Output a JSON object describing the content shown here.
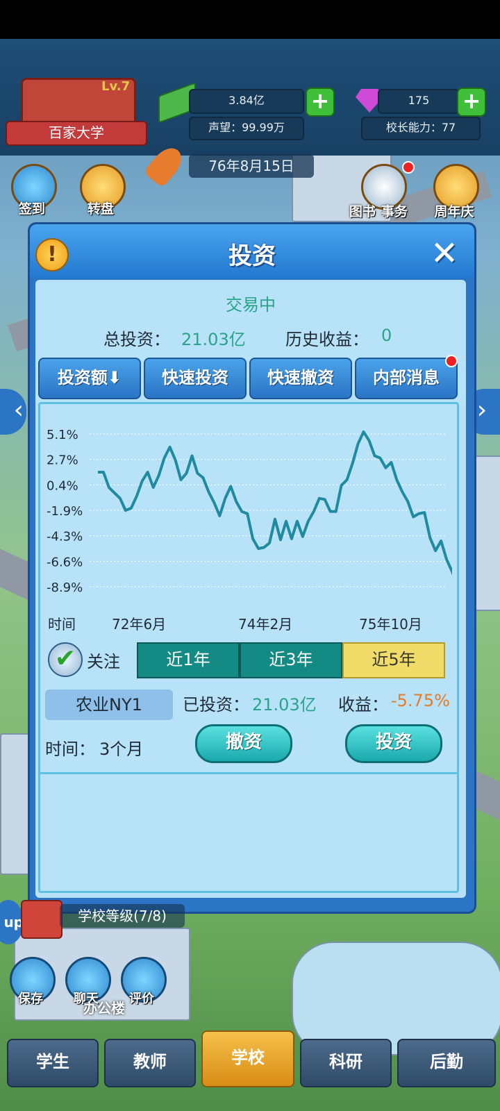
{
  "top": {
    "school_level": "Lv.7",
    "school_name": "百家大学",
    "money": "3.84亿",
    "reputation_label": "声望：",
    "reputation": "99.99万",
    "gems": "175",
    "principal_label": "校长能力：",
    "principal": "77",
    "date": "76年8月15日"
  },
  "side_left": [
    {
      "label": "签到"
    },
    {
      "label": "转盘"
    }
  ],
  "side_right": [
    {
      "label": "图书"
    },
    {
      "label": "事务"
    },
    {
      "label": "周年庆"
    }
  ],
  "dialog": {
    "title": "投资",
    "status": "交易中",
    "total_label": "总投资：",
    "total_value": "21.03亿",
    "history_label": "历史收益：",
    "history_value": "0",
    "tabs": [
      "投资额⬇",
      "快速投资",
      "快速撤资",
      "内部消息"
    ],
    "follow_label": "关注",
    "ranges": [
      "近1年",
      "近3年",
      "近5年"
    ],
    "stock_name": "农业NY1",
    "invested_label": "已投资：",
    "invested_value": "21.03亿",
    "profit_label": "收益：",
    "profit_value": "-5.75%",
    "time_label": "时间：",
    "time_value": "3个月",
    "withdraw_btn": "撤资",
    "invest_btn": "投资"
  },
  "bottom": {
    "school_rank": "学校等级(7/8)",
    "left_icons": [
      {
        "label": "保存"
      },
      {
        "label": "聊天"
      },
      {
        "label": "评价"
      }
    ],
    "building": "办公楼",
    "nav": [
      "学生",
      "教师",
      "学校",
      "科研",
      "后勤"
    ]
  },
  "colors": {
    "line": "#1f8aa0",
    "profit": "#e57b25",
    "positive": "#2aa38a",
    "active_range": "#f1dc6a",
    "range": "#148a84"
  },
  "chart_data": {
    "type": "line",
    "title": "",
    "xlabel": "时间",
    "ylabel": "",
    "x_ticks": [
      "72年6月",
      "74年2月",
      "75年10月"
    ],
    "y_ticks": [
      "5.1%",
      "2.7%",
      "0.4%",
      "-1.9%",
      "-4.3%",
      "-6.6%",
      "-8.9%"
    ],
    "ylim": [
      -8.9,
      5.1
    ],
    "grid": true,
    "series": [
      {
        "values": [
          1.6,
          1.6,
          0.2,
          -0.3,
          -0.8,
          -1.9,
          -1.7,
          -0.6,
          0.8,
          1.6,
          0.2,
          1.3,
          2.9,
          3.9,
          2.7,
          0.9,
          1.5,
          3.1,
          1.5,
          1.1,
          -0.2,
          -1.2,
          -2.4,
          -0.8,
          0.3,
          -1.1,
          -2.0,
          -2.2,
          -4.5,
          -5.4,
          -5.3,
          -4.9,
          -2.7,
          -4.6,
          -2.9,
          -4.5,
          -2.9,
          -4.3,
          -2.9,
          -2.0,
          -0.8,
          -0.9,
          -2.0,
          -2.0,
          0.4,
          0.9,
          2.4,
          4.2,
          5.3,
          4.5,
          3.1,
          2.9,
          2.0,
          2.5,
          0.9,
          -0.2,
          -1.1,
          -2.5,
          -2.2,
          -2.1,
          -4.4,
          -5.6,
          -4.7,
          -6.4,
          -7.5,
          -8.9
        ]
      }
    ]
  }
}
